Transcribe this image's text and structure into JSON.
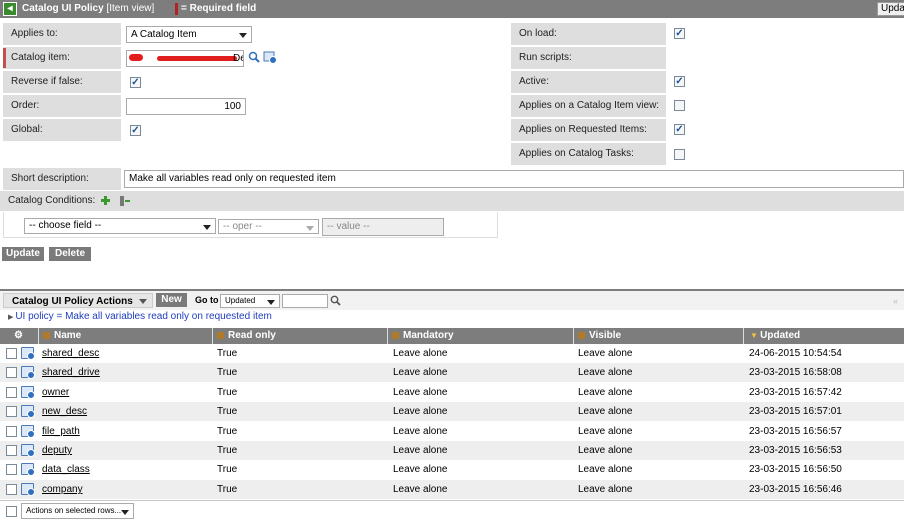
{
  "titlebar": {
    "title": "Catalog UI Policy",
    "subtitle": "[Item view]",
    "required_label": "= Required field",
    "update_label": "Update",
    "back_icon": "back-arrow-icon"
  },
  "form": {
    "applies_to_label": "Applies to:",
    "applies_to_value": "A Catalog Item",
    "catalog_item_label": "Catalog item:",
    "catalog_item_value": "De",
    "reverse_label": "Reverse if false:",
    "reverse_checked": true,
    "order_label": "Order:",
    "order_value": "100",
    "global_label": "Global:",
    "global_checked": true,
    "on_load_label": "On load:",
    "on_load_checked": true,
    "run_scripts_label": "Run scripts:",
    "active_label": "Active:",
    "active_checked": true,
    "applies_catalog_view_label": "Applies on a Catalog Item view:",
    "applies_catalog_view_checked": false,
    "applies_requested_label": "Applies on Requested Items:",
    "applies_requested_checked": true,
    "applies_tasks_label": "Applies on Catalog Tasks:",
    "applies_tasks_checked": false,
    "short_desc_label": "Short description:",
    "short_desc_value": "Make all variables read only on requested item",
    "conditions_label": "Catalog Conditions:",
    "field_select": "-- choose field --",
    "oper_select": "-- oper --",
    "value_input": "-- value --",
    "check_mark": "✓"
  },
  "actions": {
    "update_label": "Update",
    "delete_label": "Delete"
  },
  "related_list": {
    "title": "Catalog UI Policy Actions",
    "new_label": "New",
    "goto_label": "Go to",
    "goto_select": "Updated",
    "breadcrumb": "UI policy = Make all variables read only on requested item",
    "columns": [
      "Name",
      "Read only",
      "Mandatory",
      "Visible",
      "Updated"
    ],
    "rows": [
      {
        "name": "shared_desc",
        "read_only": "True",
        "mandatory": "Leave alone",
        "visible": "Leave alone",
        "updated": "24-06-2015 10:54:54"
      },
      {
        "name": "shared_drive",
        "read_only": "True",
        "mandatory": "Leave alone",
        "visible": "Leave alone",
        "updated": "23-03-2015 16:58:08"
      },
      {
        "name": "owner",
        "read_only": "True",
        "mandatory": "Leave alone",
        "visible": "Leave alone",
        "updated": "23-03-2015 16:57:42"
      },
      {
        "name": "new_desc",
        "read_only": "True",
        "mandatory": "Leave alone",
        "visible": "Leave alone",
        "updated": "23-03-2015 16:57:01"
      },
      {
        "name": "file_path",
        "read_only": "True",
        "mandatory": "Leave alone",
        "visible": "Leave alone",
        "updated": "23-03-2015 16:56:57"
      },
      {
        "name": "deputy",
        "read_only": "True",
        "mandatory": "Leave alone",
        "visible": "Leave alone",
        "updated": "23-03-2015 16:56:53"
      },
      {
        "name": "data_class",
        "read_only": "True",
        "mandatory": "Leave alone",
        "visible": "Leave alone",
        "updated": "23-03-2015 16:56:50"
      },
      {
        "name": "company",
        "read_only": "True",
        "mandatory": "Leave alone",
        "visible": "Leave alone",
        "updated": "23-03-2015 16:56:46"
      }
    ],
    "actions_select": "Actions on selected rows..."
  },
  "colors": {
    "header_gray": "#7d7d7d",
    "label_bg": "#dedede",
    "required_red": "#b22222",
    "link_blue": "#1f3fbf"
  }
}
